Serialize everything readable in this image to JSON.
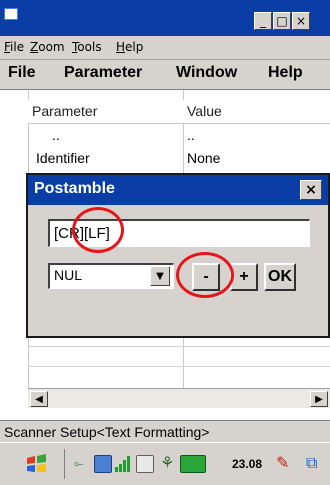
{
  "window": {
    "caption_buttons": [
      "_",
      "□",
      "×"
    ]
  },
  "outer_menu": [
    {
      "label": "File",
      "underline": "F",
      "rest": "ile"
    },
    {
      "label": "Zoom",
      "underline": "Z",
      "rest": "oom"
    },
    {
      "label": "Tools",
      "underline": "T",
      "rest": "ools"
    },
    {
      "label": "Help",
      "underline": "H",
      "rest": "elp"
    }
  ],
  "app_menu": [
    "File",
    "Parameter",
    "Window",
    "Help"
  ],
  "table": {
    "headers": [
      "Parameter",
      "Value"
    ],
    "rows": [
      {
        "parameter": "..",
        "value": ".."
      },
      {
        "parameter": "Identifier",
        "value": "None"
      }
    ]
  },
  "dialog": {
    "title": "Postamble",
    "close_label": "×",
    "input_value": "[CR][LF]",
    "select_value": "NUL",
    "buttons": {
      "minus": "-",
      "plus": "+",
      "ok": "OK"
    }
  },
  "status": {
    "text": "Scanner Setup<Text Formatting>"
  },
  "taskbar": {
    "clock": "23.08"
  },
  "colors": {
    "titlebar": "#0a3da6",
    "chrome": "#d6d3ce",
    "highlight_ring": "#e4151b"
  }
}
